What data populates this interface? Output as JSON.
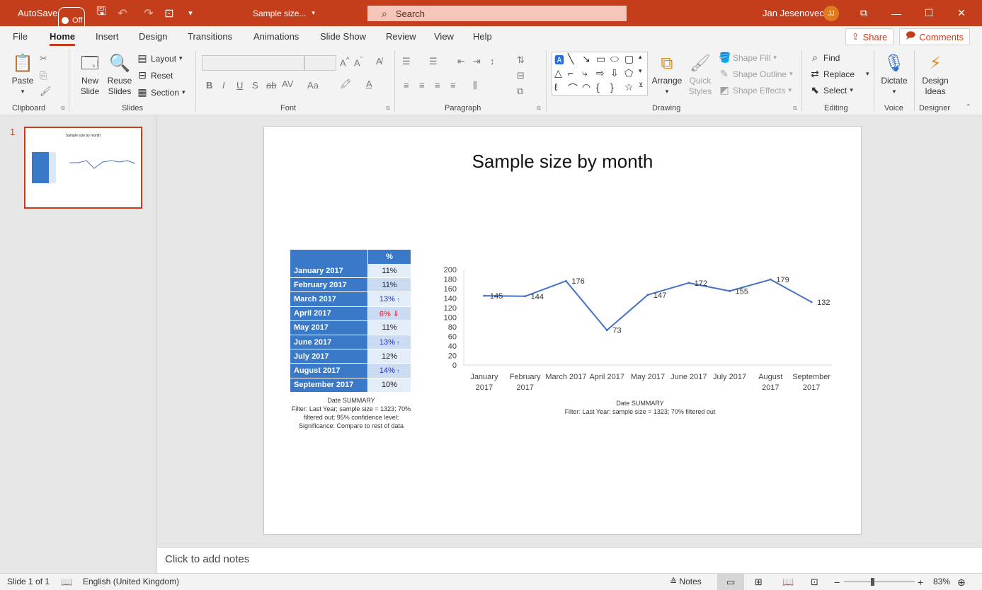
{
  "titlebar": {
    "autosave_label": "AutoSave",
    "autosave_state": "Off",
    "doc_title": "Sample size...",
    "search_placeholder": "Search",
    "user_name": "Jan Jesenovec",
    "user_initials": "JJ"
  },
  "menu": {
    "tabs": [
      "File",
      "Home",
      "Insert",
      "Design",
      "Transitions",
      "Animations",
      "Slide Show",
      "Review",
      "View",
      "Help"
    ],
    "active": "Home",
    "share_label": "Share",
    "comments_label": "Comments"
  },
  "ribbon": {
    "clipboard": {
      "label": "Clipboard",
      "paste": "Paste"
    },
    "slides": {
      "label": "Slides",
      "new_slide_1": "New",
      "new_slide_2": "Slide",
      "reuse_1": "Reuse",
      "reuse_2": "Slides",
      "layout": "Layout",
      "reset": "Reset",
      "section": "Section"
    },
    "font": {
      "label": "Font"
    },
    "paragraph": {
      "label": "Paragraph"
    },
    "drawing": {
      "label": "Drawing",
      "arrange": "Arrange",
      "quick_1": "Quick",
      "quick_2": "Styles",
      "shape_fill": "Shape Fill",
      "shape_outline": "Shape Outline",
      "shape_effects": "Shape Effects"
    },
    "editing": {
      "label": "Editing",
      "find": "Find",
      "replace": "Replace",
      "select": "Select"
    },
    "voice": {
      "label": "Voice",
      "dictate": "Dictate"
    },
    "designer": {
      "label": "Designer",
      "design_1": "Design",
      "design_2": "Ideas"
    }
  },
  "thumbnails": {
    "slide_number": "1"
  },
  "slide": {
    "title": "Sample size by month",
    "table": {
      "header": "%",
      "rows": [
        {
          "month": "January 2017",
          "value": "11%",
          "sig": ""
        },
        {
          "month": "February 2017",
          "value": "11%",
          "sig": ""
        },
        {
          "month": "March 2017",
          "value": "13%",
          "sig": "up"
        },
        {
          "month": "April 2017",
          "value": "6%",
          "sig": "down"
        },
        {
          "month": "May 2017",
          "value": "11%",
          "sig": ""
        },
        {
          "month": "June 2017",
          "value": "13%",
          "sig": "up"
        },
        {
          "month": "July 2017",
          "value": "12%",
          "sig": ""
        },
        {
          "month": "August 2017",
          "value": "14%",
          "sig": "up"
        },
        {
          "month": "September 2017",
          "value": "10%",
          "sig": ""
        }
      ],
      "note_title": "Date SUMMARY",
      "note_line1": "Filter: Last Year; sample size = 1323; 70%",
      "note_line2": "filtered out; 95% confidence level;",
      "note_line3": "Significance: Compare to rest of data"
    },
    "chart_note_title": "Date SUMMARY",
    "chart_note_line": "Filter: Last Year; sample size = 1323; 70% filtered out"
  },
  "chart_data": {
    "type": "line",
    "categories": [
      [
        "January",
        "2017"
      ],
      [
        "February",
        "2017"
      ],
      [
        "March 2017"
      ],
      [
        "April 2017"
      ],
      [
        "May 2017"
      ],
      [
        "June 2017"
      ],
      [
        "July 2017"
      ],
      [
        "August",
        "2017"
      ],
      [
        "September",
        "2017"
      ]
    ],
    "series": [
      {
        "values": [
          145,
          144,
          176,
          73,
          147,
          172,
          155,
          179,
          132
        ],
        "color": "#4472c4"
      }
    ],
    "ylim": [
      0,
      200
    ],
    "yticks": [
      0,
      20,
      40,
      60,
      80,
      100,
      120,
      140,
      160,
      180,
      200
    ],
    "grid": false,
    "data_labels": true
  },
  "notes": {
    "placeholder": "Click to add notes"
  },
  "statusbar": {
    "slide_info": "Slide 1 of 1",
    "language": "English (United Kingdom)",
    "notes_label": "Notes",
    "zoom": "83%"
  }
}
